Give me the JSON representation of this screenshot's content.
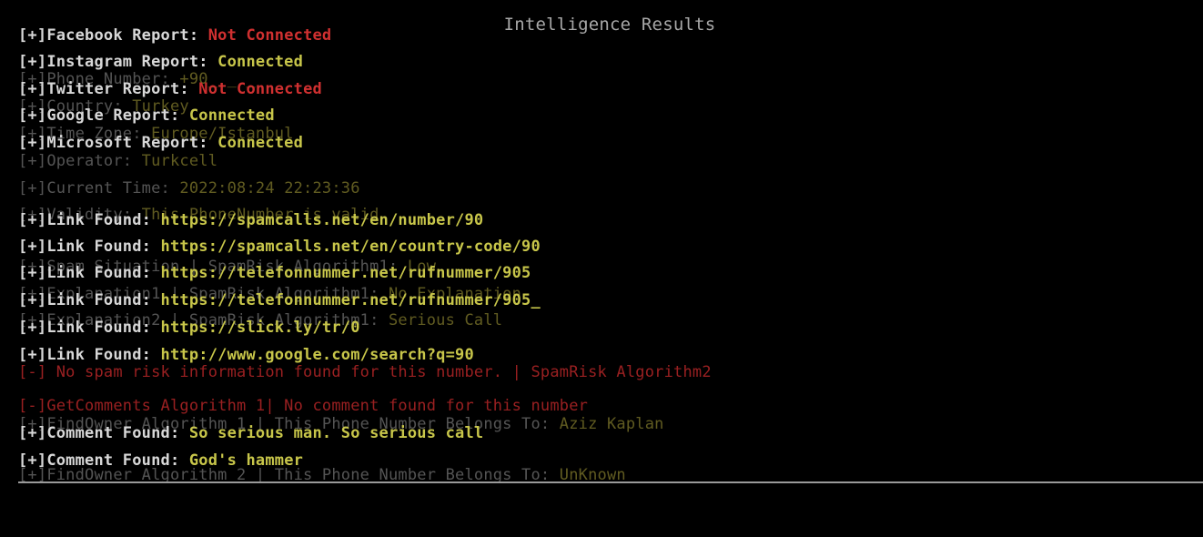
{
  "header": {
    "title": "Intelligence Results"
  },
  "background_lines": [
    {
      "prefix": "[+]",
      "label": "Phone Number: ",
      "value": "+90_ _ _"
    },
    {
      "prefix": "[+]",
      "label": "Country: ",
      "value": "Turkey"
    },
    {
      "prefix": "[+]",
      "label": "Time Zone: ",
      "value": "Europe/Istanbul"
    },
    {
      "prefix": "[+]",
      "label": "Operator: ",
      "value": "Turkcell"
    },
    {
      "prefix": "[+]",
      "label": "Current Time: ",
      "value": "2022:08:24 22:23:36"
    },
    {
      "prefix": "[+]",
      "label": "Validity: ",
      "value": "This PhoneNumber is valid"
    },
    {
      "prefix": "[+]",
      "label": "Spam Situation | SpamRisk Algorithm1: ",
      "value": "Low"
    },
    {
      "prefix": "[+]",
      "label": "Explanation1 | SpamRisk Algorithm1: ",
      "value": "No Explanation"
    },
    {
      "prefix": "[+]",
      "label": "Explanation2 | SpamRisk Algorithm1: ",
      "value": "Serious Call"
    },
    {
      "prefix": "[-] ",
      "label": "No spam risk information found for this number. | SpamRisk Algorithm2",
      "value": ""
    },
    {
      "prefix": "[-]",
      "label": "GetComments Algorithm 1| No comment found for this number",
      "value": ""
    },
    {
      "prefix": "[+]",
      "label": "FindOwner Algorithm 1 | This Phone Number Belongs To: ",
      "value": "Aziz Kaplan"
    },
    {
      "prefix": "[+]",
      "label": "FindOwner Algorithm 2 | This Phone Number Belongs To: ",
      "value": "UnKnown"
    }
  ],
  "foreground_lines": [
    {
      "prefix": "[+]",
      "label": "Facebook Report: ",
      "value": "Not Connected"
    },
    {
      "prefix": "[+]",
      "label": "Instagram Report: ",
      "value": "Connected"
    },
    {
      "prefix": "[+]",
      "label": "Twitter Report: ",
      "value": "Not Connected"
    },
    {
      "prefix": "[+]",
      "label": "Google Report: ",
      "value": "Connected"
    },
    {
      "prefix": "[+]",
      "label": "Microsoft Report: ",
      "value": "Connected"
    },
    {
      "prefix": "[+]",
      "label": "Link Found: ",
      "value": "https://spamcalls.net/en/number/90"
    },
    {
      "prefix": "[+]",
      "label": "Link Found: ",
      "value": "https://spamcalls.net/en/country-code/90"
    },
    {
      "prefix": "[+]",
      "label": "Link Found: ",
      "value": "https://telefonnummer.net/rufnummer/905"
    },
    {
      "prefix": "[+]",
      "label": "Link Found: ",
      "value": "https://telefonnummer.net/rufnummer/905_"
    },
    {
      "prefix": "[+]",
      "label": "Link Found: ",
      "value": "https://slick.ly/tr/0"
    },
    {
      "prefix": "[+]",
      "label": "Link Found: ",
      "value": "http://www.google.com/search?q=90"
    },
    {
      "prefix": "[+]",
      "label": "Comment Found: ",
      "value": "So serious man. So serious call"
    },
    {
      "prefix": "[+]",
      "label": "Comment Found: ",
      "value": "God's hammer"
    }
  ],
  "colors": {
    "background": "#000000",
    "title": "#a8a8a8",
    "tag": "#d8d8d8",
    "value_ok": "#c8c64a",
    "value_error": "#d03030",
    "error_line": "#c0282a"
  }
}
